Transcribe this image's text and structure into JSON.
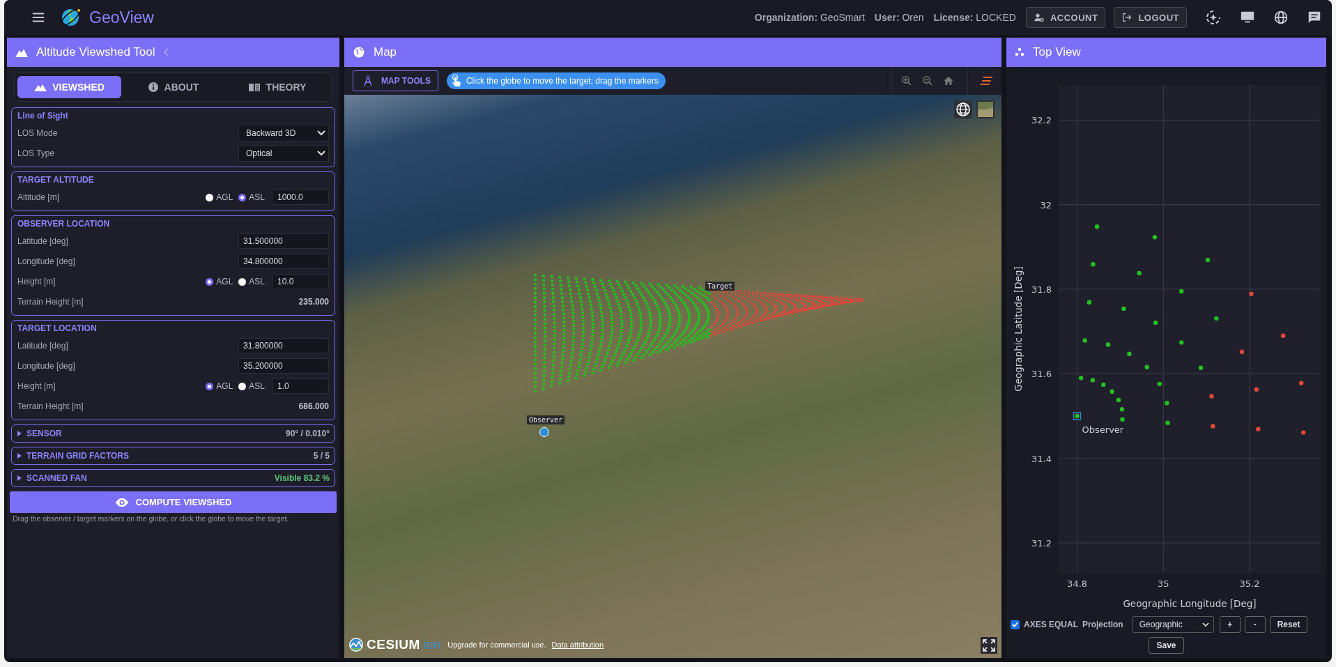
{
  "header": {
    "app_name": "GeoView",
    "organization_label": "Organization:",
    "organization": "GeoSmart",
    "user_label": "User:",
    "user": "Oren",
    "license_label": "License:",
    "license": "LOCKED",
    "buttons": [
      {
        "label": "ACCOUNT",
        "kind": "account"
      },
      {
        "label": "LOGOUT",
        "kind": "logout"
      }
    ]
  },
  "tool_panel": {
    "title": "Altitude Viewshed Tool",
    "tabs": [
      {
        "label": "VIEWSHED",
        "kind": "viewshed",
        "selected": true
      },
      {
        "label": "ABOUT",
        "kind": "about",
        "selected": false
      },
      {
        "label": "THEORY",
        "kind": "theory",
        "selected": false
      }
    ],
    "sections": [
      {
        "title": "Line of Sight",
        "rows": [
          {
            "kind": "select",
            "label": "LOS Mode",
            "value": "Backward 3D"
          },
          {
            "kind": "select",
            "label": "LOS Type",
            "value": "Optical"
          }
        ]
      },
      {
        "title": "TARGET ALTITUDE",
        "rows": [
          {
            "kind": "radio_input",
            "label": "Altitude [m]",
            "options": [
              {
                "label": "AGL",
                "selected": false
              },
              {
                "label": "ASL",
                "selected": true
              }
            ],
            "value": "1000.0"
          }
        ]
      },
      {
        "title": "OBSERVER LOCATION",
        "rows": [
          {
            "kind": "input",
            "label": "Latitude [deg]",
            "value": "31.500000"
          },
          {
            "kind": "input",
            "label": "Longitude [deg]",
            "value": "34.800000"
          },
          {
            "kind": "radio_input",
            "label": "Height [m]",
            "options": [
              {
                "label": "AGL",
                "selected": true
              },
              {
                "label": "ASL",
                "selected": false
              }
            ],
            "value": "10.0"
          },
          {
            "kind": "readout",
            "label": "Terrain Height [m]",
            "value": "235.000"
          }
        ]
      },
      {
        "title": "TARGET LOCATION",
        "rows": [
          {
            "kind": "input",
            "label": "Latitude [deg]",
            "value": "31.800000"
          },
          {
            "kind": "input",
            "label": "Longitude [deg]",
            "value": "35.200000"
          },
          {
            "kind": "radio_input",
            "label": "Height [m]",
            "options": [
              {
                "label": "AGL",
                "selected": true
              },
              {
                "label": "ASL",
                "selected": false
              }
            ],
            "value": "1.0"
          },
          {
            "kind": "readout",
            "label": "Terrain Height [m]",
            "value": "686.000"
          }
        ]
      }
    ],
    "collapsibles": [
      {
        "title": "SENSOR",
        "value": "90° / 0.010°",
        "kind": "plain",
        "expanded": false
      },
      {
        "title": "TERRAIN GRID FACTORS",
        "value": "5 / 5",
        "kind": "plain",
        "expanded": false
      },
      {
        "title": "SCANNED FAN",
        "value": "Visible 83.2 %",
        "kind": "success",
        "expanded": false
      }
    ],
    "compute_button": "COMPUTE VIEWSHED",
    "hint": "Drag the observer / target markers on the globe, or click the globe to move the target."
  },
  "map": {
    "title": "Map",
    "tools_button": "MAP TOOLS",
    "hint": "Click the globe to move the target; drag the markers",
    "markers": [
      {
        "label": "Target",
        "kind": "target"
      },
      {
        "label": "Observer",
        "kind": "observer"
      }
    ],
    "credit": {
      "logo": "CESIUM",
      "logo_suffix": "ion",
      "notice": "Upgrade for commercial use.",
      "link": "Data attribution"
    }
  },
  "top_view": {
    "title": "Top View",
    "chart_data": {
      "type": "scatter",
      "xlabel": "Geographic Longitude [Deg]",
      "ylabel": "Geographic Latitude [Deg]",
      "xlim": [
        34.757,
        35.365
      ],
      "ylim": [
        31.129,
        32.283
      ],
      "xticks": [
        34.8,
        35,
        35.2
      ],
      "yticks": [
        31.2,
        31.4,
        31.6,
        31.8,
        32,
        32.2
      ],
      "series": [
        {
          "color": "#22c21e",
          "x": [
            34.8,
            34.809,
            34.836,
            34.861,
            34.881,
            34.896,
            34.904,
            34.905,
            34.818,
            34.872,
            34.921,
            34.962,
            34.991,
            35.008,
            35.01,
            34.828,
            34.908,
            34.982,
            35.042,
            35.087,
            34.837,
            34.944,
            35.042,
            35.123,
            34.846,
            34.98,
            35.103
          ],
          "values": [
            31.5,
            31.59,
            31.585,
            31.574,
            31.558,
            31.538,
            31.516,
            31.492,
            31.679,
            31.669,
            31.647,
            31.616,
            31.576,
            31.531,
            31.484,
            31.769,
            31.754,
            31.721,
            31.674,
            31.614,
            31.859,
            31.838,
            31.795,
            31.731,
            31.948,
            31.923,
            31.869
          ]
        },
        {
          "color": "#e0483c",
          "x": [
            35.112,
            35.115,
            35.182,
            35.216,
            35.22,
            35.204,
            35.278,
            35.32,
            35.325
          ],
          "values": [
            31.547,
            31.476,
            31.652,
            31.563,
            31.469,
            31.789,
            31.69,
            31.578,
            31.461
          ]
        }
      ],
      "grid": true,
      "annotations": [
        {
          "text": "Observer",
          "x": 34.8,
          "y": 31.5
        }
      ]
    },
    "axes_equal": {
      "label": "AXES EQUAL",
      "checked": true
    },
    "projection": {
      "label": "Projection",
      "value": "Geographic"
    },
    "buttons": [
      "+",
      "-",
      "Reset"
    ],
    "save_button": "Save"
  }
}
